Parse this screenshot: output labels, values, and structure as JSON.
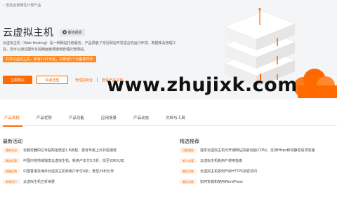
{
  "breadcrumb": {
    "back_label": "查看全部弹性计算产品"
  },
  "hero": {
    "title": "云虚拟主机",
    "video_label": "播放视频",
    "desc_line1": "云虚拟主机（Web Hosting）是一种网站托管服务，产品预装了常见网站开发语言的运行环境、数据库及管理工",
    "desc_line2": "具，您可以通过图形化控制面板便捷地管理托管网站。",
    "promo": "共享云虚拟主机，新客1元1年起，买即送1个月备案时长",
    "primary_button": "立即购买",
    "secondary_button": "快速选型",
    "link_console": "管理控制台",
    "link_docs": "查看产品文档"
  },
  "watermark": "www.zhujixk.com",
  "tabs": [
    "产品规格",
    "产品优势",
    "产品功能",
    "应用场景",
    "产品动态",
    "文档与工具"
  ],
  "latest": {
    "title": "最新活动",
    "items": [
      {
        "tag": "最新活动",
        "text": "云服务器四亿补贴购指低至1.8折起，更有专属上云补贴通道"
      },
      {
        "tag": "精选优惠",
        "text": "中国内地地域独享云虚拟主机，新用户年付3.5折，低至206元/年"
      },
      {
        "tag": "限量促销",
        "text": "中国香港及海外云虚拟主机新用户年付4折，低至298元/年"
      },
      {
        "tag": "新老用户",
        "text": "云虚拟主机五折续费"
      }
    ]
  },
  "featured": {
    "title": "精选推荐",
    "items": [
      {
        "tag": "功能更新",
        "text": "独享云虚拟主机可开通网站加速功能(CDN)，支持Https和动静态请求加速"
      },
      {
        "tag": "新人必看",
        "text": "云虚拟主机新用户使用指南"
      },
      {
        "tag": "最佳实践",
        "text": "云虚拟主机如何开启HTTPS加密访问"
      },
      {
        "tag": "最佳实践",
        "text": "如何安装和使用WordPress"
      }
    ]
  },
  "colors": {
    "accent": "#ff6a00",
    "hero_bg": "#f4f5f7",
    "tag_bg": "#fff0e6"
  }
}
